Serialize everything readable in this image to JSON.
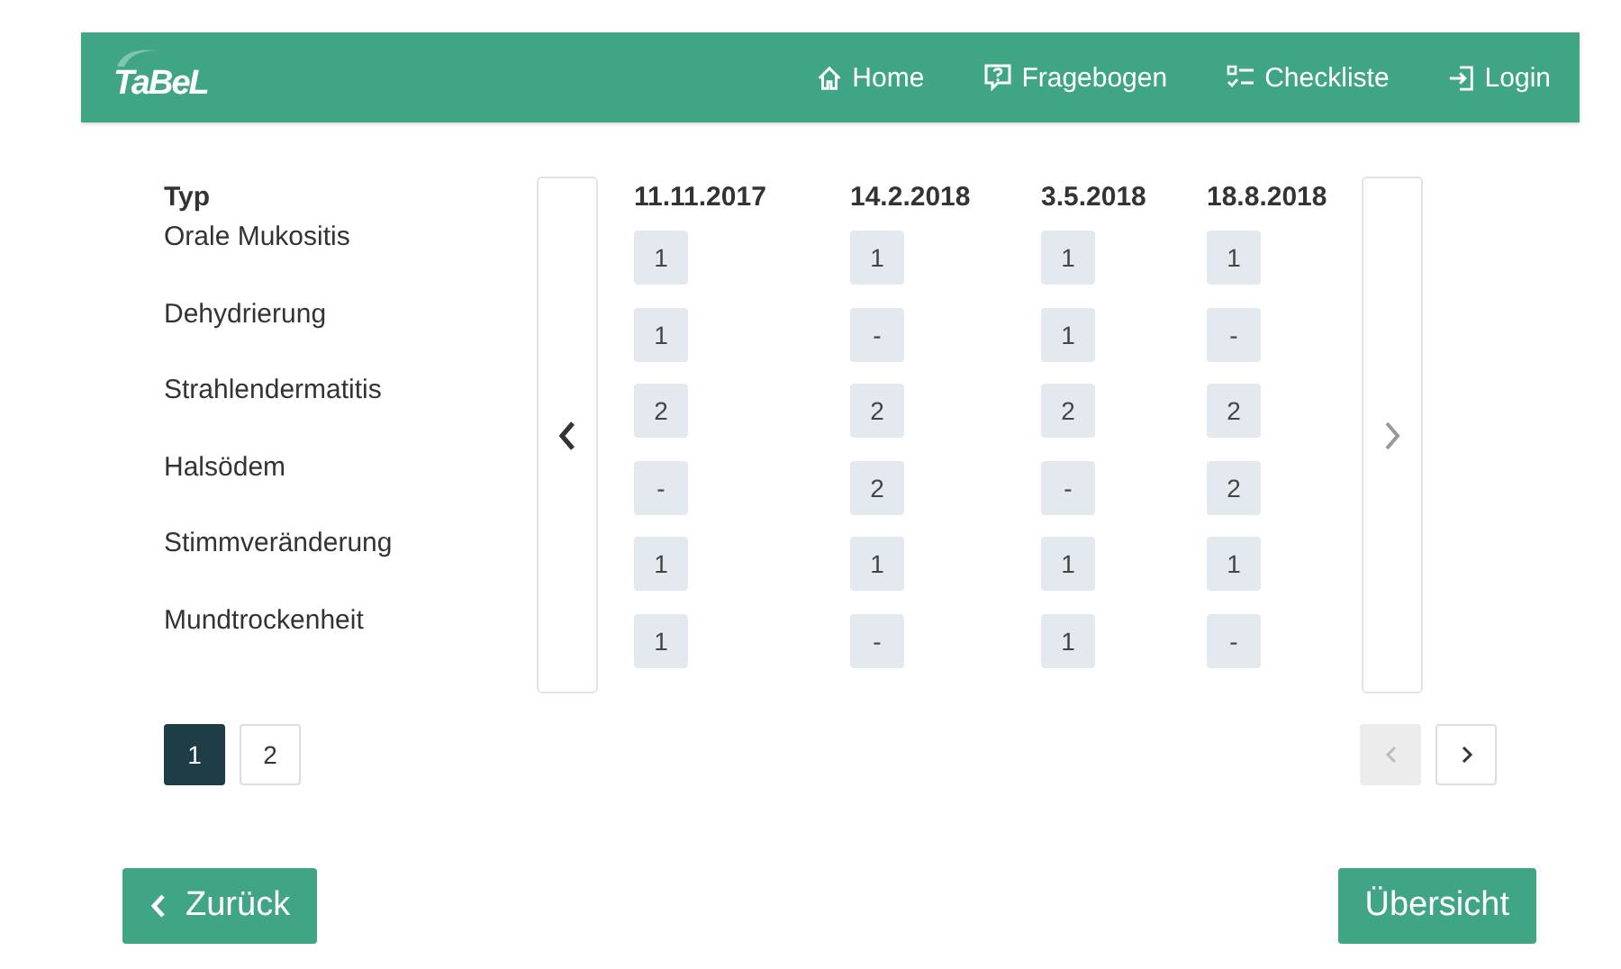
{
  "navbar": {
    "logo": "TaBeL",
    "items": [
      {
        "kind": "home",
        "label": "Home"
      },
      {
        "kind": "questionnaire",
        "label": "Fragebogen"
      },
      {
        "kind": "checklist",
        "label": "Checkliste"
      },
      {
        "kind": "login",
        "label": "Login"
      }
    ]
  },
  "table": {
    "type_heading": "Typ",
    "dates": [
      "11.11.2017",
      "14.2.2018",
      "3.5.2018",
      "18.8.2018"
    ],
    "rows": [
      {
        "label": "Orale Mukositis",
        "values": [
          "1",
          "1",
          "1",
          "1"
        ]
      },
      {
        "label": "Dehydrierung",
        "values": [
          "1",
          "-",
          "1",
          "-"
        ]
      },
      {
        "label": "Strahlendermatitis",
        "values": [
          "2",
          "2",
          "2",
          "2"
        ]
      },
      {
        "label": "Halsödem",
        "values": [
          "-",
          "2",
          "-",
          "2"
        ]
      },
      {
        "label": "Stimmveränderung",
        "values": [
          "1",
          "1",
          "1",
          "1"
        ]
      },
      {
        "label": "Mundtrockenheit",
        "values": [
          "1",
          "-",
          "1",
          "-"
        ]
      }
    ]
  },
  "pagination": {
    "pages": [
      {
        "label": "1",
        "selected": true
      },
      {
        "label": "2",
        "selected": false
      }
    ],
    "prev_disabled": true,
    "next_disabled": false
  },
  "buttons": {
    "back": "Zurück",
    "overview": "Übersicht"
  }
}
